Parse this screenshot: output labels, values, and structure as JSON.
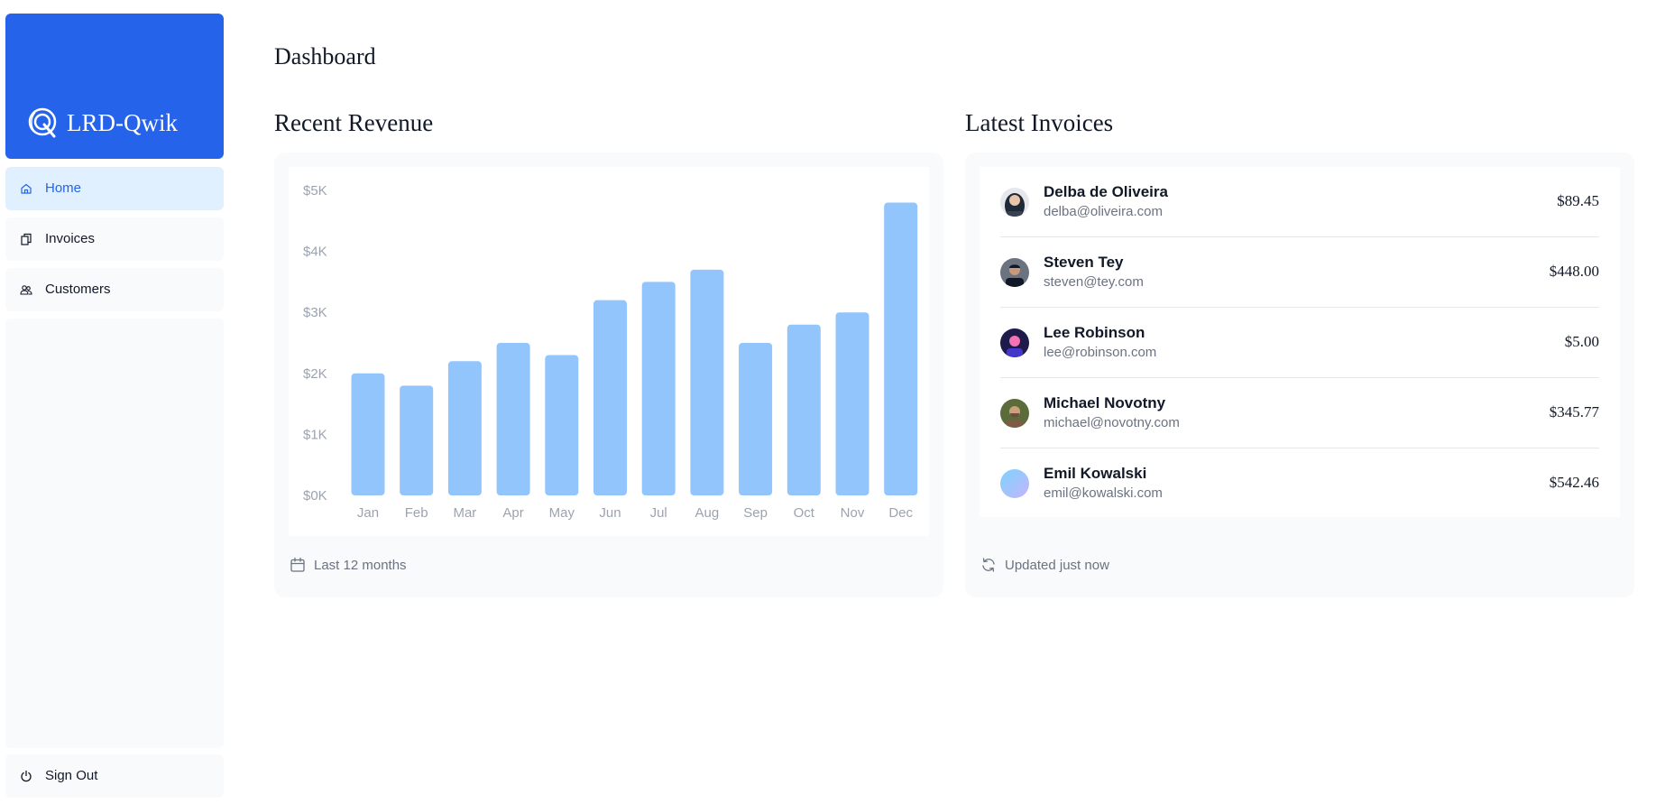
{
  "brand": {
    "name": "LRD-Qwik"
  },
  "nav": {
    "items": [
      {
        "label": "Home",
        "icon": "home-icon",
        "active": true
      },
      {
        "label": "Invoices",
        "icon": "invoices-icon",
        "active": false
      },
      {
        "label": "Customers",
        "icon": "customers-icon",
        "active": false
      }
    ],
    "signout": {
      "label": "Sign Out",
      "icon": "power-icon"
    }
  },
  "page": {
    "title": "Dashboard"
  },
  "revenue": {
    "title": "Recent Revenue",
    "footer": "Last 12 months",
    "footer_icon": "calendar-icon"
  },
  "chart_data": {
    "type": "bar",
    "categories": [
      "Jan",
      "Feb",
      "Mar",
      "Apr",
      "May",
      "Jun",
      "Jul",
      "Aug",
      "Sep",
      "Oct",
      "Nov",
      "Dec"
    ],
    "values": [
      2000,
      1800,
      2200,
      2500,
      2300,
      3200,
      3500,
      3700,
      2500,
      2800,
      3000,
      4800
    ],
    "y_ticks": [
      "$0K",
      "$1K",
      "$2K",
      "$3K",
      "$4K",
      "$5K"
    ],
    "ylim": [
      0,
      5000
    ],
    "bar_color": "#93c5fd",
    "grid": false
  },
  "invoices": {
    "title": "Latest Invoices",
    "footer": "Updated just now",
    "footer_icon": "refresh-icon",
    "items": [
      {
        "name": "Delba de Oliveira",
        "email": "delba@oliveira.com",
        "amount": "$89.45"
      },
      {
        "name": "Steven Tey",
        "email": "steven@tey.com",
        "amount": "$448.00"
      },
      {
        "name": "Lee Robinson",
        "email": "lee@robinson.com",
        "amount": "$5.00"
      },
      {
        "name": "Michael Novotny",
        "email": "michael@novotny.com",
        "amount": "$345.77"
      },
      {
        "name": "Emil Kowalski",
        "email": "emil@kowalski.com",
        "amount": "$542.46"
      }
    ]
  },
  "colors": {
    "primary": "#2563eb",
    "active_bg": "#e0f0fe",
    "panel_bg": "#f9fafb",
    "bar": "#93c5fd"
  }
}
